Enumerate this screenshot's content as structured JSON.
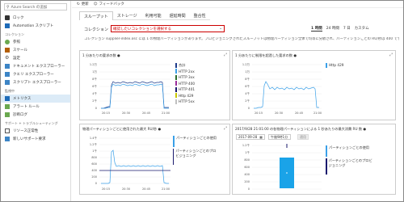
{
  "sidebar": {
    "search_placeholder": "Azure Search の追加",
    "items_top": [
      {
        "label": "Azure Search の追加"
      },
      {
        "label": "ロック"
      },
      {
        "label": "Automation スクリプト"
      }
    ],
    "section1": "コレクション",
    "items_coll": [
      {
        "label": "参照"
      },
      {
        "label": "スケール"
      },
      {
        "label": "設定"
      },
      {
        "label": "ドキュメント エクスプローラー"
      },
      {
        "label": "クエリ エクスプローラー"
      },
      {
        "label": "スクリプト エクスプローラー"
      }
    ],
    "section2": "監視中",
    "items_mon": [
      {
        "label": "メトリクス",
        "active": true
      },
      {
        "label": "アラート ルール"
      },
      {
        "label": "診断ログ"
      }
    ],
    "section3": "サポート + トラブルシューティング",
    "items_sup": [
      {
        "label": "リソース正常性"
      },
      {
        "label": "新しいサポート要求"
      }
    ]
  },
  "topbar": {
    "refresh": "更新",
    "feedback": "フィードバック"
  },
  "tabs": [
    "スループット",
    "ストレージ",
    "利用可能",
    "遅延時間",
    "整合性"
  ],
  "collection": {
    "label": "コレクション",
    "select_value": "確認したいコレクションを選択する"
  },
  "time_tabs": [
    "1 時間",
    "24 時間",
    "7 日",
    "カスタム"
  ],
  "description": {
    "line1": "コレクション supplier-index.osc には 1 の物理パーティションがあります。プロビジョニングされたスループットは物理パーティション全体で均等に分散され、パーティションごとの RU/秒は 400 です。",
    "line2": ""
  },
  "charts": {
    "c1": {
      "title": "1 分あたりの要求の数 ●",
      "legend": [
        {
          "label": "合計",
          "color": "#1e3a8a"
        },
        {
          "label": "HTTP 2xx",
          "color": "#3aa0e8"
        },
        {
          "label": "HTTP 3xx",
          "color": "#2d6d2d"
        },
        {
          "label": "HTTP 400",
          "color": "#9b2c9b"
        },
        {
          "label": "HTTP 401",
          "color": "#1a1a6e"
        },
        {
          "label": "Http 429",
          "color": "#c8c800"
        },
        {
          "label": "HTTP 5xx",
          "color": "#c0c0c0"
        }
      ],
      "yticks": [
        "1.2万",
        "1万",
        "8千",
        "6千",
        "4千",
        "2千",
        "0"
      ],
      "xticks": [
        "20:15",
        "20:30",
        "20:45",
        "21:00"
      ]
    },
    "c2": {
      "title": "1 分あたりに制限を超過した要求の数 ●",
      "legend": [
        {
          "label": "Http 429",
          "color": "#3aa0e8"
        }
      ],
      "yticks": [
        "1.2万",
        "1万",
        "8千",
        "6千",
        "4千",
        "2千",
        "0"
      ],
      "xticks": [
        "20:15",
        "20:30",
        "20:45",
        "21:00"
      ]
    },
    "c3": {
      "title": "物理パーティションごとに使用された最大 RU/秒 ●",
      "legend": [
        {
          "label": "パーティションごとの使用",
          "color": "#3aa0e8"
        },
        {
          "label": "パーティションごとのプロビジョニング",
          "color": "#1a1a6e"
        }
      ],
      "yticks": [
        "1.4千",
        "1.2千",
        "1千",
        "800",
        "600",
        "400",
        "200",
        "0"
      ],
      "xticks": [
        "20:15",
        "20:30",
        "20:45",
        "21:00"
      ]
    },
    "c4": {
      "title": "2017/9/28 21:01:00 の各物理パーティションによる 1 秒あたりの最大消費 RU 数 ●",
      "date": "2017-09-28",
      "time": "午後9時1分",
      "apply": "適用",
      "legend": [
        {
          "label": "パーティションごとの使用",
          "color": "#3aa0e8"
        },
        {
          "label": "パーティションごとのプロビジョニング",
          "color": "#1a1a6e"
        }
      ],
      "yticks": [
        "1.2千",
        "1千",
        "800",
        "600",
        "400",
        "200",
        "0"
      ]
    }
  }
}
